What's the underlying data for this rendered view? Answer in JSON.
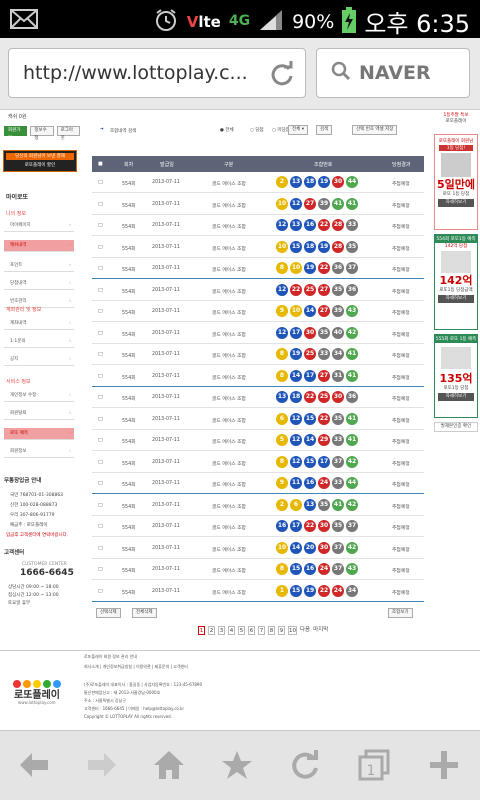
{
  "statusbar": {
    "volte": "V",
    "lte": "lte",
    "net": "4G",
    "battery": "90%",
    "time": "오후 6:35"
  },
  "browser": {
    "url": "http://www.lottoplay.c...",
    "search_label": "NAVER"
  },
  "left_sidebar": {
    "top_notice": "캐쉬 0원",
    "buttons": [
      "회원가입",
      "정보수정",
      "로그아웃"
    ],
    "banner1": "당신의 회원님이 보낸 결재",
    "banner2": "로또플레이 할인",
    "menu_title": "마이로또",
    "section1_title": "나의 정보",
    "section1_items": [
      "마이페이지",
      "캐쉬내역",
      "포인트"
    ],
    "section2_items": [
      "당첨내역",
      "번호관리"
    ],
    "section3_title": "계좌관리 및 정보",
    "section3_items": [
      "계좌내역",
      "1:1문의",
      "공지"
    ],
    "section4_title": "서비스 정보",
    "section4_items": [
      "개인정보 수정",
      "회원탈퇴",
      "로또 예측",
      "회원정보"
    ],
    "cs_title": "무통장입금 안내",
    "cs_lines": [
      "국민 768701-01-308863",
      "신한 100-028-088873",
      "우리 307-806-91779",
      "예금주 : 로또플레이",
      "입금후 고객센터에 연락바랍니다."
    ],
    "cs_center_title": "고객센터",
    "cs_center_label": "CUSTOMER CENTER",
    "cs_phone": "1666-6645",
    "cs_hours": [
      "상담시간 09:00 ~ 18:00",
      "점심시간 12:00 ~ 13:00",
      "토요일 휴무"
    ]
  },
  "main": {
    "search": {
      "title": "조합내역 검색",
      "filters": [
        "전체",
        "당첨",
        "미당첨"
      ],
      "select_value": "전체",
      "search_button": "검색",
      "save_button": "선택 번호 엑셀 저장"
    },
    "table": {
      "headers": [
        "회차",
        "발급일",
        "구분",
        "조합번호",
        "당첨결과"
      ],
      "rows": [
        {
          "round": "554회",
          "date": "2013-07-11",
          "type": "골드 에이스 조합",
          "balls": [
            2,
            13,
            18,
            19,
            30,
            44
          ],
          "result": "추첨예정"
        },
        {
          "round": "554회",
          "date": "2013-07-11",
          "type": "골드 에이스 조합",
          "balls": [
            10,
            12,
            27,
            39,
            41,
            41
          ],
          "result": "추첨예정"
        },
        {
          "round": "554회",
          "date": "2013-07-11",
          "type": "골드 에이스 조합",
          "balls": [
            12,
            13,
            16,
            22,
            28,
            33
          ],
          "result": "추첨예정"
        },
        {
          "round": "554회",
          "date": "2013-07-11",
          "type": "골드 에이스 조합",
          "balls": [
            10,
            15,
            18,
            19,
            28,
            35
          ],
          "result": "추첨예정"
        },
        {
          "round": "554회",
          "date": "2013-07-11",
          "type": "골드 에이스 조합",
          "balls": [
            8,
            10,
            19,
            22,
            36,
            37
          ],
          "result": "추첨예정"
        },
        {
          "round": "554회",
          "date": "2013-07-11",
          "type": "골드 에이스 조합",
          "balls": [
            12,
            22,
            25,
            27,
            35,
            36
          ],
          "result": "추첨예정"
        },
        {
          "round": "554회",
          "date": "2013-07-11",
          "type": "골드 에이스 조합",
          "balls": [
            9,
            10,
            14,
            27,
            39,
            43
          ],
          "result": "추첨예정"
        },
        {
          "round": "554회",
          "date": "2013-07-11",
          "type": "골드 에이스 조합",
          "balls": [
            12,
            17,
            30,
            35,
            40,
            42
          ],
          "result": "추첨예정"
        },
        {
          "round": "554회",
          "date": "2013-07-11",
          "type": "골드 에이스 조합",
          "balls": [
            8,
            19,
            25,
            33,
            34,
            41
          ],
          "result": "추첨예정"
        },
        {
          "round": "554회",
          "date": "2013-07-11",
          "type": "골드 에이스 조합",
          "balls": [
            8,
            14,
            17,
            27,
            31,
            41
          ],
          "result": "추첨예정"
        },
        {
          "round": "554회",
          "date": "2013-07-11",
          "type": "골드 에이스 조합",
          "balls": [
            13,
            18,
            22,
            25,
            30,
            36
          ],
          "result": "추첨예정"
        },
        {
          "round": "554회",
          "date": "2013-07-11",
          "type": "골드 에이스 조합",
          "balls": [
            6,
            12,
            15,
            22,
            35,
            41
          ],
          "result": "추첨예정"
        },
        {
          "round": "554회",
          "date": "2013-07-11",
          "type": "골드 에이스 조합",
          "balls": [
            5,
            12,
            14,
            29,
            33,
            41
          ],
          "result": "추첨예정"
        },
        {
          "round": "554회",
          "date": "2013-07-11",
          "type": "골드 에이스 조합",
          "balls": [
            8,
            12,
            15,
            17,
            37,
            42
          ],
          "result": "추첨예정"
        },
        {
          "round": "554회",
          "date": "2013-07-11",
          "type": "골드 에이스 조합",
          "balls": [
            9,
            11,
            16,
            24,
            33,
            44
          ],
          "result": "추첨예정"
        },
        {
          "round": "554회",
          "date": "2013-07-11",
          "type": "골드 에이스 조합",
          "balls": [
            2,
            6,
            13,
            35,
            41,
            42
          ],
          "result": "추첨예정"
        },
        {
          "round": "554회",
          "date": "2013-07-11",
          "type": "골드 에이스 조합",
          "balls": [
            16,
            17,
            22,
            30,
            35,
            37
          ],
          "result": "추첨예정"
        },
        {
          "round": "554회",
          "date": "2013-07-11",
          "type": "골드 에이스 조합",
          "balls": [
            10,
            14,
            20,
            30,
            37,
            42
          ],
          "result": "추첨예정"
        },
        {
          "round": "554회",
          "date": "2013-07-11",
          "type": "골드 에이스 조합",
          "balls": [
            8,
            15,
            16,
            24,
            37,
            43
          ],
          "result": "추첨예정"
        },
        {
          "round": "554회",
          "date": "2013-07-11",
          "type": "골드 에이스 조합",
          "balls": [
            1,
            15,
            19,
            22,
            24,
            34
          ],
          "result": "추첨예정"
        }
      ]
    },
    "bottom_buttons": [
      "선택삭제",
      "전체삭제",
      "조합보기"
    ],
    "pagination": {
      "pages": [
        "1",
        "2",
        "3",
        "4",
        "5",
        "6",
        "7",
        "8",
        "9",
        "10"
      ],
      "current": "1",
      "next": "다음",
      "last": "마지막"
    }
  },
  "right_sidebar": {
    "top_title": "1등주말 특보",
    "top_text": "로또플레이",
    "b1_title": "로또플레이 회원님",
    "b1_text": "1등 당첨!",
    "b1_big": "5일만에",
    "b1_small": "로또 1등 당첨",
    "b1_btn": "자세히보기",
    "b2_header": "554회 로또1등 예측",
    "b2_text": "142억 당첨",
    "b2_big": "142억",
    "b2_small": "로또1등 당첨금액",
    "b2_btn": "자세히보기",
    "b3_header": "555회 로또 1등 예측",
    "b3_big": "135억",
    "b3_small": "로또1등 당첨",
    "b3_btn": "자세히보기",
    "bottom_link": "발재본인증 확인"
  },
  "footer": {
    "logo_text": "로또플레이",
    "logo_sub": "www.lottoplay.com",
    "lines": [
      "로또플레이 회원 정보 관리 안내",
      "회사소개 | 개인정보취급방침 | 이용약관 | 제휴문의 | 고객센터",
      "(주)로또플레이 대표이사 : 홍길동 | 사업자등록번호 : 123-45-67890",
      "통신판매업신고 : 제 2013-서울강남-0000호",
      "주소 : 서울특별시 강남구",
      "고객센터 : 1666-6645 | 이메일 : help@lottoplay.co.kr",
      "Copyright © LOTTOPLAY All rights reserved."
    ]
  }
}
